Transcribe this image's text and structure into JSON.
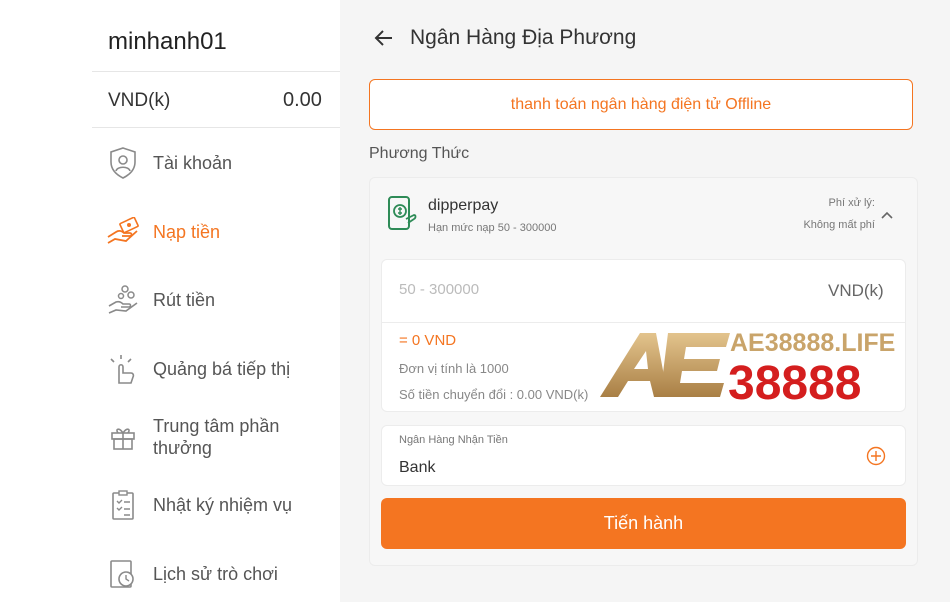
{
  "account": {
    "username": "minhanh01",
    "currency_label": "VND(k)",
    "balance": "0.00"
  },
  "sidebar": {
    "items": [
      {
        "label": "Tài khoản",
        "icon": "shield-user-icon",
        "active": false
      },
      {
        "label": "Nạp tiền",
        "icon": "deposit-hand-icon",
        "active": true
      },
      {
        "label": "Rút tiền",
        "icon": "withdraw-coins-icon",
        "active": false
      },
      {
        "label": "Quảng bá tiếp thị",
        "icon": "marketing-hand-icon",
        "active": false
      },
      {
        "label": "Trung tâm phần thưởng",
        "icon": "gift-icon",
        "active": false
      },
      {
        "label": "Nhật ký nhiệm vụ",
        "icon": "clipboard-icon",
        "active": false
      },
      {
        "label": "Lịch sử trò chơi",
        "icon": "history-icon",
        "active": false
      }
    ]
  },
  "header": {
    "title": "Ngân Hàng Địa Phương"
  },
  "offline_button": {
    "label": "thanh toán ngân hàng điện tử Offline"
  },
  "method_section": {
    "label": "Phương Thức"
  },
  "method": {
    "name": "dipperpay",
    "limit": "Hạn mức nạp 50 - 300000",
    "fee_label": "Phí xử lý:",
    "fee_value": "Không mất phí"
  },
  "amount": {
    "placeholder": "50 - 300000",
    "unit": "VND(k)",
    "equivalent": "= 0 VND",
    "unit_note": "Đơn vị tính là 1000",
    "conversion_note": "Số tiền chuyển đổi : 0.00 VND(k)"
  },
  "bank": {
    "label": "Ngân Hàng Nhận Tiền",
    "value": "Bank"
  },
  "submit": {
    "label": "Tiến hành"
  },
  "watermark": {
    "site": "AE38888.LIFE",
    "brand": "38888",
    "letters": "AE"
  },
  "colors": {
    "accent": "#f47521",
    "green": "#2e8b57",
    "watermark_red": "#d41e1e",
    "watermark_gold": "#c9a46a"
  }
}
